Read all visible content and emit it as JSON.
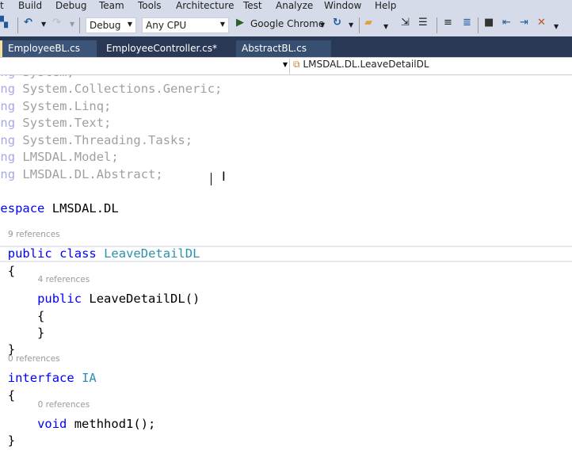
{
  "menu": [
    "t",
    "Build",
    "Debug",
    "Team",
    "Tools",
    "Architecture",
    "Test",
    "Analyze",
    "Window",
    "Help"
  ],
  "toolbar": {
    "configuration": "Debug",
    "platform": "Any CPU",
    "run_target": "Google Chrome"
  },
  "tabs": [
    {
      "label": "EmployeeBL.cs"
    },
    {
      "label": "EmployeeController.cs*"
    },
    {
      "label": "AbstractBL.cs"
    }
  ],
  "navbar": {
    "type_member": "LMSDAL.DL.LeaveDetailDL"
  },
  "code": [
    {
      "faded": true,
      "segs": [
        [
          "kw",
          "using"
        ],
        [
          "tx",
          " System;"
        ]
      ]
    },
    {
      "faded": true,
      "segs": [
        [
          "kw",
          "using"
        ],
        [
          "tx",
          " System.Collections.Generic;"
        ]
      ]
    },
    {
      "faded": true,
      "segs": [
        [
          "kw",
          "using"
        ],
        [
          "tx",
          " System.Linq;"
        ]
      ]
    },
    {
      "faded": true,
      "segs": [
        [
          "kw",
          "using"
        ],
        [
          "tx",
          " System.Text;"
        ]
      ]
    },
    {
      "faded": true,
      "segs": [
        [
          "kw",
          "using"
        ],
        [
          "tx",
          " System.Threading.Tasks;"
        ]
      ]
    },
    {
      "faded": true,
      "segs": [
        [
          "kw",
          "using"
        ],
        [
          "tx",
          " LMSDAL.Model;"
        ]
      ]
    },
    {
      "faded": true,
      "segs": [
        [
          "kw",
          "using"
        ],
        [
          "tx",
          " LMSDAL.DL.Abstract;"
        ]
      ]
    },
    {
      "segs": []
    },
    {
      "segs": [
        [
          "kw",
          "namespace"
        ],
        [
          "tx",
          " LMSDAL.DL"
        ]
      ]
    },
    {
      "segs": []
    },
    {
      "ref": "9 references",
      "indent": 4,
      "segs": [
        [
          "tx",
          "    "
        ],
        [
          "kw",
          "public"
        ],
        [
          "tx",
          " "
        ],
        [
          "kw",
          "class"
        ],
        [
          "tx",
          " "
        ],
        [
          "ty",
          "LeaveDetailDL"
        ]
      ]
    },
    {
      "segs": [
        [
          "tx",
          "    {"
        ]
      ]
    },
    {
      "ref": "4 references",
      "indent": 8,
      "segs": [
        [
          "tx",
          "        "
        ],
        [
          "kw",
          "public"
        ],
        [
          "tx",
          " LeaveDetailDL()"
        ]
      ]
    },
    {
      "segs": [
        [
          "tx",
          "        {"
        ]
      ]
    },
    {
      "segs": [
        [
          "tx",
          "        }"
        ]
      ]
    },
    {
      "segs": [
        [
          "tx",
          "    }"
        ]
      ]
    },
    {
      "ref": "0 references",
      "indent": 4,
      "segs": [
        [
          "tx",
          "    "
        ],
        [
          "kw",
          "interface"
        ],
        [
          "tx",
          " "
        ],
        [
          "ty",
          "IA"
        ]
      ]
    },
    {
      "segs": [
        [
          "tx",
          "    {"
        ]
      ]
    },
    {
      "ref": "0 references",
      "indent": 8,
      "segs": [
        [
          "tx",
          "        "
        ],
        [
          "kw",
          "void"
        ],
        [
          "tx",
          " methhod1();"
        ]
      ]
    },
    {
      "segs": [
        [
          "tx",
          "    }"
        ]
      ]
    }
  ]
}
